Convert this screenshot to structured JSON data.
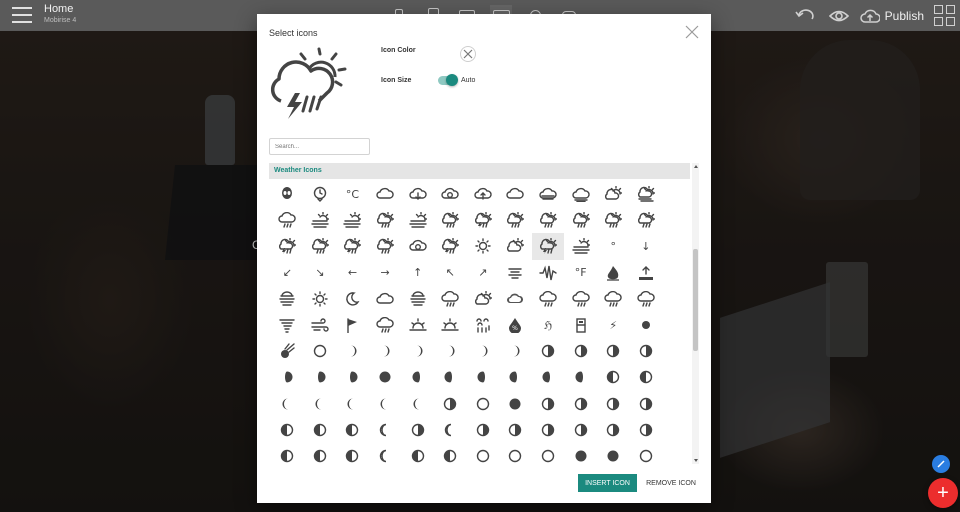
{
  "topbar": {
    "title": "Home",
    "subtitle": "Mobirise 4",
    "publish_label": "Publish"
  },
  "background": {
    "partial_text": "C"
  },
  "modal": {
    "title": "Select icons",
    "icon_color_label": "Icon Color",
    "icon_size_label": "Icon Size",
    "size_value": "Auto",
    "size_auto_enabled": true,
    "search_placeholder": "Search...",
    "category": "Weather Icons",
    "insert_label": "INSERT ICON",
    "remove_label": "REMOVE ICON",
    "selected_index": 32
  },
  "colors": {
    "accent": "#1b8a7f",
    "fab_red": "#ec2d2d",
    "fab_blue": "#2a7de1"
  },
  "icons": [
    {
      "name": "alien-icon",
      "g": "alien"
    },
    {
      "name": "clock-icon",
      "g": "clock"
    },
    {
      "name": "celsius-icon",
      "t": "°C"
    },
    {
      "name": "cloud-icon",
      "g": "cloud"
    },
    {
      "name": "cloud-down-icon",
      "g": "clouddown"
    },
    {
      "name": "cloud-refresh-icon",
      "g": "cloudrefresh"
    },
    {
      "name": "cloud-up-icon",
      "g": "cloudup"
    },
    {
      "name": "cloudy-icon",
      "g": "cloud"
    },
    {
      "name": "cloud-wind-icon",
      "g": "cloudwind"
    },
    {
      "name": "cloud-fog-icon",
      "g": "cloudfog"
    },
    {
      "name": "day-sunny-overcast-icon",
      "g": "suncloud"
    },
    {
      "name": "day-windy-icon",
      "g": "suncloudwind"
    },
    {
      "name": "day-sprinkle-icon",
      "g": "cloudrain"
    },
    {
      "name": "day-fog-icon",
      "g": "sunfog"
    },
    {
      "name": "day-haze-icon",
      "g": "sunfog"
    },
    {
      "name": "day-rain-icon",
      "g": "sunrain"
    },
    {
      "name": "day-sunny-mist-icon",
      "g": "sunfog"
    },
    {
      "name": "day-light-wind-icon",
      "g": "sunrain"
    },
    {
      "name": "day-thunderstorm-icon",
      "g": "sunstorm"
    },
    {
      "name": "day-showers-icon",
      "g": "sunrain"
    },
    {
      "name": "day-sleet-icon",
      "g": "sunrain"
    },
    {
      "name": "day-rain-mix-icon",
      "g": "sunrain"
    },
    {
      "name": "day-snow-icon",
      "g": "sunrain"
    },
    {
      "name": "day-hail-icon",
      "g": "sunrain"
    },
    {
      "name": "day-storm-showers-icon",
      "g": "sunstorm"
    },
    {
      "name": "day-sleet-storm-icon",
      "g": "sunrain"
    },
    {
      "name": "day-snow-thunderstorm-icon",
      "g": "sunstorm"
    },
    {
      "name": "day-rain-wind-icon",
      "g": "sunrain"
    },
    {
      "name": "day-cloudy-gusts-icon",
      "g": "cloudrefresh"
    },
    {
      "name": "day-lightning-icon",
      "g": "sunstorm"
    },
    {
      "name": "day-sunny-icon",
      "g": "sun"
    },
    {
      "name": "day-cloudy-high-icon",
      "g": "suncloud"
    },
    {
      "name": "day-storm-selected-icon",
      "g": "sunstorm"
    },
    {
      "name": "day-haze-wind-icon",
      "g": "sunfog"
    },
    {
      "name": "degrees-icon",
      "t": "°"
    },
    {
      "name": "arrow-down-icon",
      "t": "↓"
    },
    {
      "name": "arrow-down-left-icon",
      "t": "↙"
    },
    {
      "name": "arrow-down-right-icon",
      "t": "↘"
    },
    {
      "name": "arrow-left-icon",
      "t": "←"
    },
    {
      "name": "arrow-right-icon",
      "t": "→"
    },
    {
      "name": "arrow-up-icon",
      "t": "↑"
    },
    {
      "name": "arrow-up-left-icon",
      "t": "↖"
    },
    {
      "name": "arrow-up-right-icon",
      "t": "↗"
    },
    {
      "name": "dust-icon",
      "g": "lines"
    },
    {
      "name": "earthquake-icon",
      "g": "quake"
    },
    {
      "name": "fahrenheit-icon",
      "t": "°F"
    },
    {
      "name": "fire-icon",
      "g": "fire"
    },
    {
      "name": "flood-icon",
      "g": "flood"
    },
    {
      "name": "fog-icon",
      "g": "fog"
    },
    {
      "name": "sun-outline-icon",
      "g": "sun"
    },
    {
      "name": "moon-icon",
      "g": "moon"
    },
    {
      "name": "cloudy-day-icon",
      "g": "cloud"
    },
    {
      "name": "horizon-icon",
      "g": "fog"
    },
    {
      "name": "showers-icon",
      "g": "cloudrain"
    },
    {
      "name": "partly-cloudy-icon",
      "g": "suncloud"
    },
    {
      "name": "cloud-solid-icon",
      "g": "cloudfill"
    },
    {
      "name": "rain-icon",
      "g": "cloudrain"
    },
    {
      "name": "sleet-icon",
      "g": "cloudrain"
    },
    {
      "name": "snow-icon",
      "g": "cloudrain"
    },
    {
      "name": "thunderstorm-icon",
      "g": "cloudrain"
    },
    {
      "name": "hurricane-icon",
      "g": "tornado"
    },
    {
      "name": "strong-wind-icon",
      "g": "wind"
    },
    {
      "name": "small-craft-advisory-icon",
      "g": "flag"
    },
    {
      "name": "rain-mix-icon",
      "g": "cloudrain"
    },
    {
      "name": "sunrise-icon",
      "g": "sunrise"
    },
    {
      "name": "sunset-icon",
      "g": "sunrise"
    },
    {
      "name": "sandstorm-icon",
      "g": "sandstorm"
    },
    {
      "name": "humidity-icon",
      "g": "drop"
    },
    {
      "name": "hurricane-symbol-icon",
      "t": "ℌ"
    },
    {
      "name": "barometer-icon",
      "g": "baro"
    },
    {
      "name": "lightning-icon",
      "t": "⚡"
    },
    {
      "name": "moon-new-icon",
      "g": "half"
    },
    {
      "name": "meteor-icon",
      "g": "meteor"
    },
    {
      "name": "moon-full-outline-icon",
      "g": "ring"
    },
    {
      "name": "moon-waxing-crescent-1-icon",
      "g": "crescR"
    },
    {
      "name": "moon-waxing-crescent-2-icon",
      "g": "crescR"
    },
    {
      "name": "moon-waxing-crescent-3-icon",
      "g": "crescR"
    },
    {
      "name": "moon-waxing-crescent-4-icon",
      "g": "crescR"
    },
    {
      "name": "moon-waxing-crescent-5-icon",
      "g": "crescR"
    },
    {
      "name": "moon-waxing-crescent-6-icon",
      "g": "crescR"
    },
    {
      "name": "moon-first-quarter-icon",
      "g": "halfR"
    },
    {
      "name": "moon-waxing-gibbous-1-icon",
      "g": "halfR"
    },
    {
      "name": "moon-waxing-gibbous-2-icon",
      "g": "halfR"
    },
    {
      "name": "moon-waxing-gibbous-3-icon",
      "g": "halfR"
    },
    {
      "name": "moon-waxing-gibbous-4-icon",
      "g": "gibR"
    },
    {
      "name": "moon-waxing-gibbous-5-icon",
      "g": "gibR"
    },
    {
      "name": "moon-waxing-gibbous-6-icon",
      "g": "gibR"
    },
    {
      "name": "moon-full-icon",
      "g": "full"
    },
    {
      "name": "moon-waning-gibbous-1-icon",
      "g": "gibL"
    },
    {
      "name": "moon-waning-gibbous-2-icon",
      "g": "gibL"
    },
    {
      "name": "moon-waning-gibbous-3-icon",
      "g": "gibL"
    },
    {
      "name": "moon-waning-gibbous-4-icon",
      "g": "gibL"
    },
    {
      "name": "moon-waning-gibbous-5-icon",
      "g": "gibL"
    },
    {
      "name": "moon-waning-gibbous-6-icon",
      "g": "gibL"
    },
    {
      "name": "moon-third-quarter-icon",
      "g": "halfL"
    },
    {
      "name": "moon-waning-crescent-1-icon",
      "g": "halfL"
    },
    {
      "name": "moon-waning-crescent-2-icon",
      "g": "crescL"
    },
    {
      "name": "moon-waning-crescent-3-icon",
      "g": "crescL"
    },
    {
      "name": "moon-waning-crescent-4-icon",
      "g": "crescL"
    },
    {
      "name": "moon-waning-crescent-5-icon",
      "g": "crescL"
    },
    {
      "name": "moon-waning-crescent-6-icon",
      "g": "crescL"
    },
    {
      "name": "moon-alt-first-quarter-icon",
      "g": "halfR"
    },
    {
      "name": "moon-alt-new-icon",
      "g": "ring"
    },
    {
      "name": "moon-alt-full-icon",
      "g": "full"
    },
    {
      "name": "moon-alt-waxing-gibbous-icon",
      "g": "halfR"
    },
    {
      "name": "moon-alt-third-quarter-icon",
      "g": "halfR"
    },
    {
      "name": "moon-alt-waning-gibbous-icon",
      "g": "halfR"
    },
    {
      "name": "moon-alt-waning-crescent-icon",
      "g": "halfR"
    },
    {
      "name": "moon-alt-crescent-1-icon",
      "g": "halfL"
    },
    {
      "name": "moon-alt-crescent-2-icon",
      "g": "halfL"
    },
    {
      "name": "moon-alt-crescent-3-icon",
      "g": "halfL"
    },
    {
      "name": "moon-alt-crescent-4-icon",
      "g": "crescLo"
    },
    {
      "name": "moon-alt-crescent-5-icon",
      "g": "halfR"
    },
    {
      "name": "moon-alt-crescent-6-icon",
      "g": "crescLo"
    },
    {
      "name": "moon-alt-gibbous-1-icon",
      "g": "halfR"
    },
    {
      "name": "moon-alt-gibbous-2-icon",
      "g": "halfR"
    },
    {
      "name": "moon-alt-gibbous-3-icon",
      "g": "halfR"
    },
    {
      "name": "moon-alt-gibbous-4-icon",
      "g": "halfR"
    },
    {
      "name": "moon-alt-gibbous-5-icon",
      "g": "halfR"
    },
    {
      "name": "moon-alt-gibbous-6-icon",
      "g": "halfR"
    },
    {
      "name": "moon-alt-1-icon",
      "g": "halfL"
    },
    {
      "name": "moon-alt-2-icon",
      "g": "halfL"
    },
    {
      "name": "moon-alt-3-icon",
      "g": "halfL"
    },
    {
      "name": "moon-alt-4-icon",
      "g": "crescLo"
    },
    {
      "name": "moon-alt-5-icon",
      "g": "halfL"
    },
    {
      "name": "moon-alt-6-icon",
      "g": "halfL"
    },
    {
      "name": "moon-alt-7-icon",
      "g": "ringL"
    },
    {
      "name": "moon-alt-8-icon",
      "g": "ring"
    },
    {
      "name": "moon-alt-9-icon",
      "g": "ring"
    },
    {
      "name": "moon-alt-10-icon",
      "g": "full"
    },
    {
      "name": "moon-alt-11-icon",
      "g": "full"
    },
    {
      "name": "moon-alt-12-icon",
      "g": "ring"
    }
  ]
}
